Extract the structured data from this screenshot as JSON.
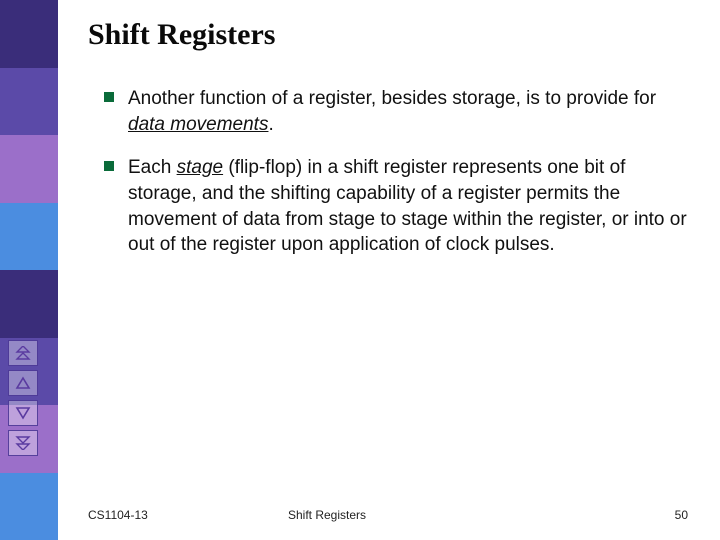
{
  "title": "Shift Registers",
  "bullets": [
    {
      "pre": "Another function of a register, besides storage, is to provide for ",
      "em": "data movements",
      "post": "."
    },
    {
      "pre": "Each ",
      "em": "stage",
      "post": " (flip-flop) in a shift register represents one bit of storage, and the shifting capability of a register permits the movement of data from stage to stage within the register, or into or out of the register upon application of clock pulses."
    }
  ],
  "footer": {
    "left": "CS1104-13",
    "center": "Shift Registers",
    "right": "50"
  },
  "nav": {
    "first": "first-slide",
    "prev": "previous-slide",
    "next": "next-slide",
    "last": "last-slide"
  }
}
